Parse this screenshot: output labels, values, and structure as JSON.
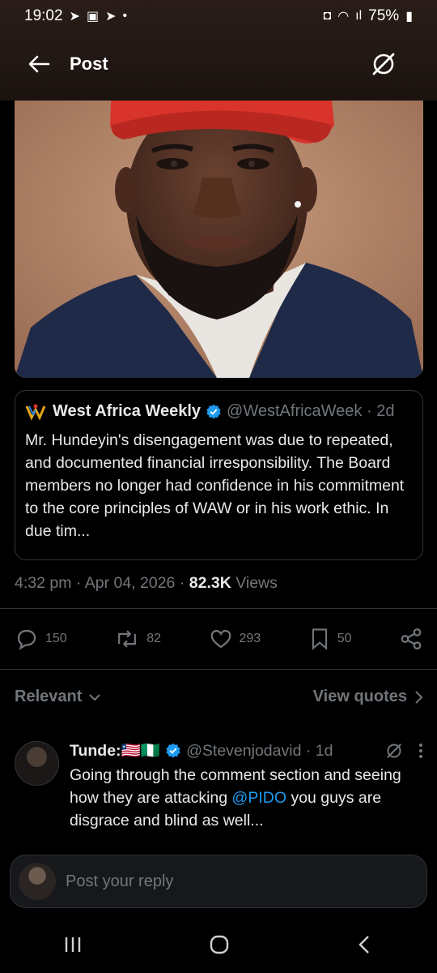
{
  "status_bar": {
    "time": "19:02",
    "battery": "75%"
  },
  "header": {
    "title": "Post"
  },
  "quote": {
    "author_name": "West Africa Weekly",
    "handle": "@WestAfricaWeek",
    "time": "2d",
    "text": "Mr. Hundeyin's disengagement was due to repeated, and documented financial irresponsibility. The Board members no longer had confidence in his commitment to the core principles of WAW or in his work ethic. In due tim..."
  },
  "meta": {
    "timestamp": "4:32 pm",
    "date": "Apr 04, 2026",
    "views_count": "82.3K",
    "views_label": "Views"
  },
  "actions": {
    "replies": "150",
    "reposts": "82",
    "likes": "293",
    "bookmarks": "50"
  },
  "sort": {
    "relevant_label": "Relevant",
    "view_quotes_label": "View quotes"
  },
  "reply": {
    "name": "Tunde:",
    "flags": "🇱🇷🇳🇬",
    "handle": "@Stevenjodavid",
    "time": "1d",
    "text_before": "Going through the comment section and seeing how they are attacking ",
    "mention": "@PIDO",
    "text_after": " you guys are disgrace and blind as well..."
  },
  "composer": {
    "placeholder": "Post your reply"
  },
  "colors": {
    "background": "#000000",
    "muted": "#71767b",
    "accent": "#1d9bf0",
    "hat": "#d8342b"
  }
}
